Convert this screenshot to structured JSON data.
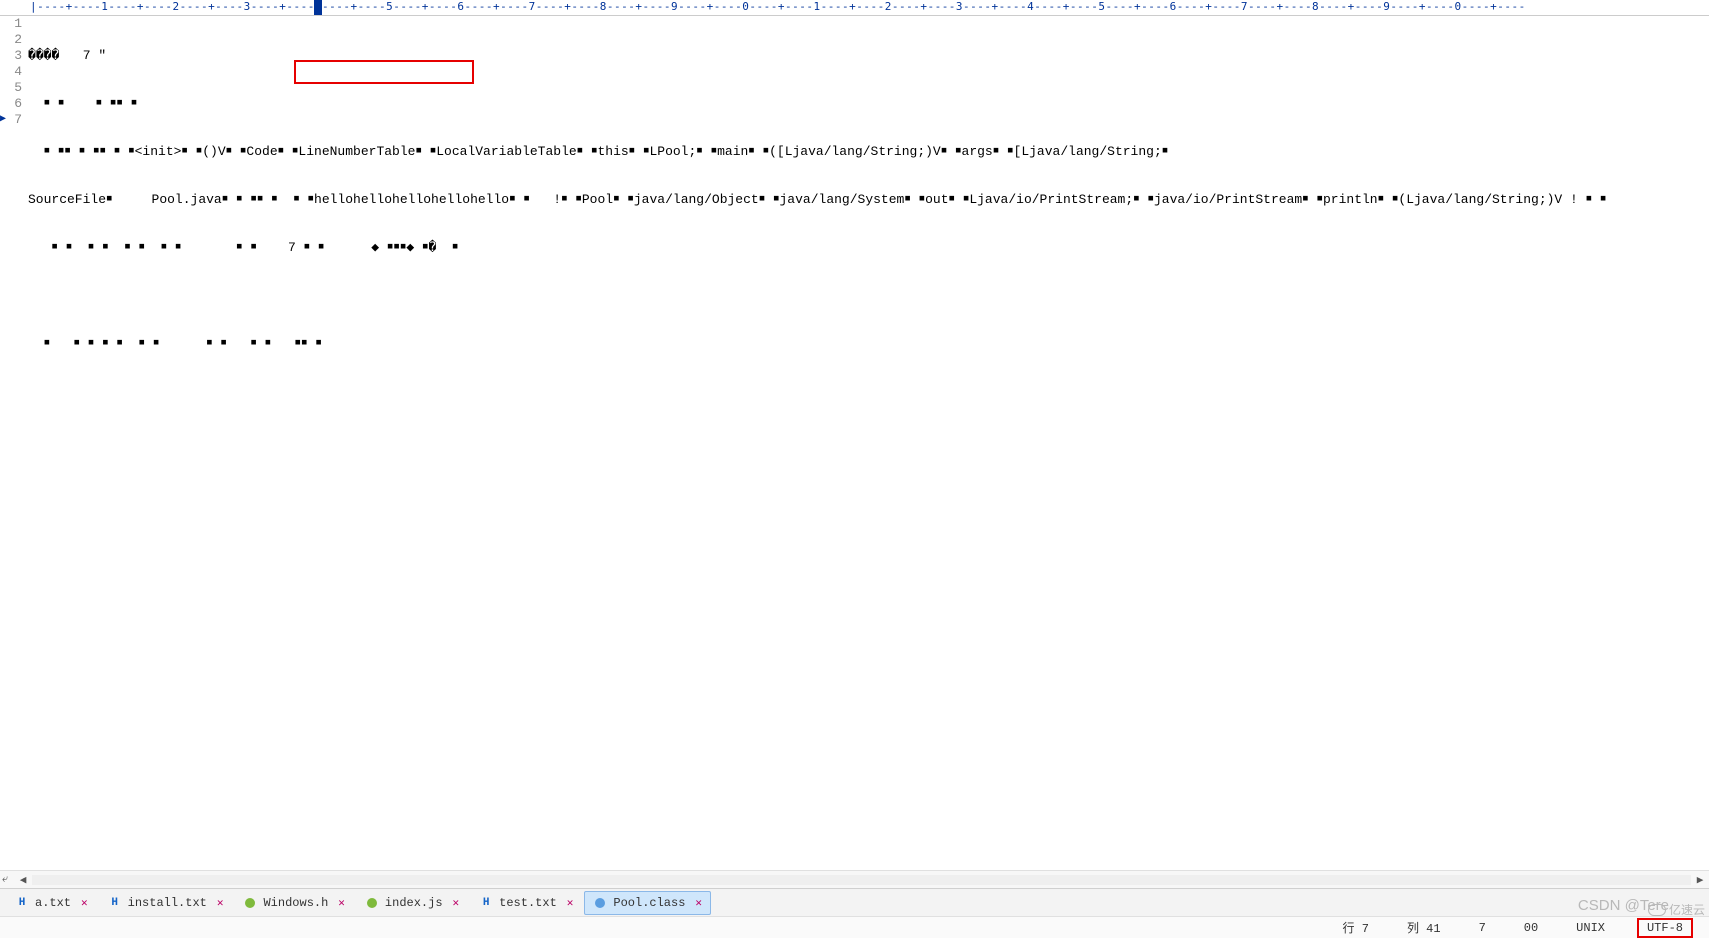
{
  "ruler": {
    "text": "|----+----1----+----2----+----3----+----4----+----5----+----6----+----7----+----8----+----9----+----0----+----1----+----2----+----3----+----4----+----5----+----6----+----7----+----8----+----9----+----0----+----"
  },
  "lines": {
    "nums": [
      "1",
      "2",
      "3",
      "4",
      "5",
      "6",
      "7"
    ],
    "l1": "����   7 \"",
    "l2": "  ￭ ￭    ￭ ￭￭ ￭",
    "l3": "  ￭ ￭￭ ￭ ￭￭ ￭ ￭<init>￭ ￭()V￭ ￭Code￭ ￭LineNumberTable￭ ￭LocalVariableTable￭ ￭this￭ ￭LPool;￭ ￭main￭ ￭([Ljava/lang/String;)V￭ ￭args￭ ￭[Ljava/lang/String;￭",
    "l4": "SourceFile￭     Pool.java￭ ￭ ￭￭ ￭  ￭ ￭hellohellohellohellohello￭ ￭   !￭ ￭Pool￭ ￭java/lang/Object￭ ￭java/lang/System￭ ￭out￭ ￭Ljava/io/PrintStream;￭ ￭java/io/PrintStream￭ ￭println￭ ￭(Ljava/lang/String;)V ! ￭ ￭",
    "l5": "   ￭ ￭  ￭ ￭  ￭ ￭  ￭ ￭       ￭ ￭    7 ￭ ￭      ◆ ￭￭￭◆ ￭�  ￭",
    "l6": "",
    "l7": "  ￭   ￭ ￭ ￭ ￭  ￭ ￭      ￭ ￭   ￭ ￭   ￭￭ ￭"
  },
  "tabs": {
    "items": [
      {
        "label": "a.txt",
        "icon": "h"
      },
      {
        "label": "install.txt",
        "icon": "h"
      },
      {
        "label": "Windows.h",
        "icon": "js"
      },
      {
        "label": "index.js",
        "icon": "js"
      },
      {
        "label": "test.txt",
        "icon": "h"
      },
      {
        "label": "Pool.class",
        "icon": "cls"
      }
    ],
    "close_glyph": "✕"
  },
  "status": {
    "row_label": "行",
    "row_value": "7",
    "col_label": "列",
    "col_value": "41",
    "field3": "7",
    "field4": "00",
    "eol": "UNIX",
    "encoding": "UTF-8"
  },
  "watermark": "CSDN @Tere",
  "watermark2": "亿速云"
}
